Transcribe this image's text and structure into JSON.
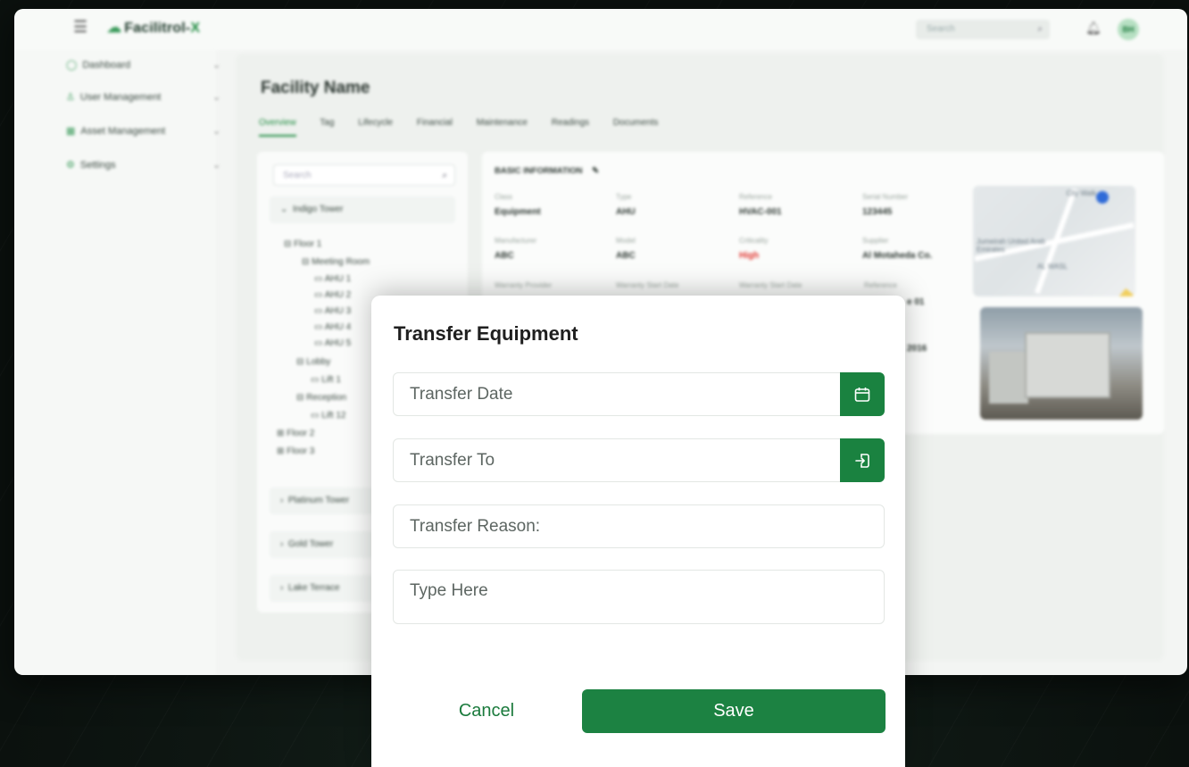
{
  "app": {
    "logo_text": "Facilitrol-",
    "logo_x": "X",
    "search_placeholder": "Search",
    "avatar_initials": "BH",
    "brand_color": "#1c8242"
  },
  "sidebar": {
    "items": [
      {
        "label": "Dashboard",
        "icon": "dashboard-icon"
      },
      {
        "label": "User Management",
        "icon": "user-icon"
      },
      {
        "label": "Asset Management",
        "icon": "grid-icon"
      },
      {
        "label": "Settings",
        "icon": "gear-icon"
      }
    ]
  },
  "page": {
    "title": "Facility Name",
    "tabs": [
      "Overview",
      "Tag",
      "Lifecycle",
      "Financial",
      "Maintenance",
      "Readings",
      "Documents"
    ],
    "active_tab": "Overview"
  },
  "tree": {
    "search_placeholder": "Search",
    "towers": [
      "Indigo Tower",
      "Platinum Tower",
      "Gold Tower",
      "Lake Terrace"
    ],
    "nodes": [
      "Floor 1",
      "Meeting Room",
      "AHU 1",
      "AHU 2",
      "AHU 3",
      "AHU 4",
      "AHU 5",
      "Lobby",
      "Lift 1",
      "Reception",
      "Lift 12",
      "Floor 2",
      "Floor 3"
    ]
  },
  "basic_info": {
    "heading": "BASIC INFORMATION",
    "rows": [
      [
        {
          "label": "Class",
          "value": "Equipment"
        },
        {
          "label": "Type",
          "value": "AHU"
        },
        {
          "label": "Reference",
          "value": "HVAC-001"
        },
        {
          "label": "Serial Number",
          "value": "123445"
        }
      ],
      [
        {
          "label": "Manufacturer",
          "value": "ABC"
        },
        {
          "label": "Model",
          "value": "ABC"
        },
        {
          "label": "Criticality",
          "value": "High"
        },
        {
          "label": "Supplier",
          "value": "Al Motaheda Co."
        }
      ]
    ],
    "row3_labels": [
      "Warranty Provider",
      "Warranty Start Date",
      "Warranty Start Date",
      "Reference"
    ],
    "partial_values": [
      "e 01",
      "2016"
    ],
    "map_labels": [
      "City Walk",
      "Jumeirah United Arab Emirates",
      "AL WASL"
    ]
  },
  "modal": {
    "title": "Transfer Equipment",
    "transfer_date_placeholder": "Transfer Date",
    "transfer_to_placeholder": "Transfer To",
    "transfer_reason_placeholder": "Transfer Reason:",
    "type_here_placeholder": "Type Here",
    "cancel_label": "Cancel",
    "save_label": "Save",
    "calendar_icon": "calendar-icon",
    "transfer_icon": "transfer-in-icon"
  }
}
